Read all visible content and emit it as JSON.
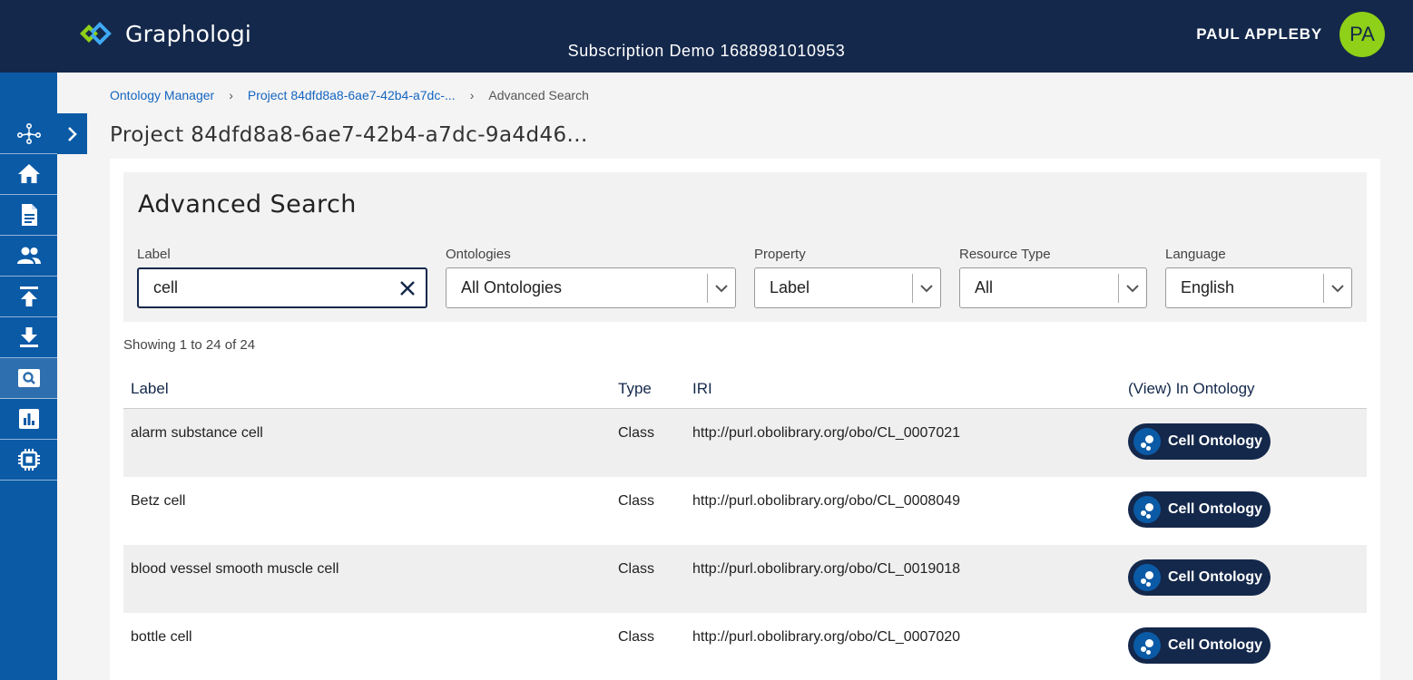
{
  "header": {
    "brand": "Graphologi",
    "workspace": "Subscription Demo 1688981010953",
    "user_name": "PAUL APPLEBY",
    "user_initials": "PA"
  },
  "sidebar": {
    "items": [
      {
        "icon": "graph-network-icon"
      },
      {
        "icon": "home-icon"
      },
      {
        "icon": "document-icon"
      },
      {
        "icon": "users-icon"
      },
      {
        "icon": "upload-icon"
      },
      {
        "icon": "download-icon"
      },
      {
        "icon": "search-icon",
        "active": true
      },
      {
        "icon": "chart-icon"
      },
      {
        "icon": "processor-icon"
      }
    ]
  },
  "breadcrumb": {
    "items": [
      "Ontology Manager",
      "Project 84dfd8a8-6ae7-42b4-a7dc-..."
    ],
    "current": "Advanced Search"
  },
  "page_title": "Project 84dfd8a8-6ae7-42b4-a7dc-9a4d46...",
  "search": {
    "title": "Advanced Search",
    "label_field": {
      "label": "Label",
      "value": "cell"
    },
    "ontologies": {
      "label": "Ontologies",
      "value": "All Ontologies"
    },
    "property": {
      "label": "Property",
      "value": "Label"
    },
    "resource_type": {
      "label": "Resource Type",
      "value": "All"
    },
    "language": {
      "label": "Language",
      "value": "English"
    }
  },
  "results": {
    "showing": "Showing 1 to 24 of 24",
    "columns": [
      "Label",
      "Type",
      "IRI",
      "(View) In Ontology"
    ],
    "rows": [
      {
        "label": "alarm substance cell",
        "type": "Class",
        "iri": "http://purl.obolibrary.org/obo/CL_0007021",
        "ontology": "Cell Ontology"
      },
      {
        "label": "Betz cell",
        "type": "Class",
        "iri": "http://purl.obolibrary.org/obo/CL_0008049",
        "ontology": "Cell Ontology"
      },
      {
        "label": "blood vessel smooth muscle cell",
        "type": "Class",
        "iri": "http://purl.obolibrary.org/obo/CL_0019018",
        "ontology": "Cell Ontology"
      },
      {
        "label": "bottle cell",
        "type": "Class",
        "iri": "http://purl.obolibrary.org/obo/CL_0007020",
        "ontology": "Cell Ontology"
      }
    ]
  },
  "colors": {
    "header_bg": "#14284b",
    "sidebar_bg": "#0b5aa6",
    "avatar_bg": "#8fd018",
    "link": "#1565c0"
  }
}
